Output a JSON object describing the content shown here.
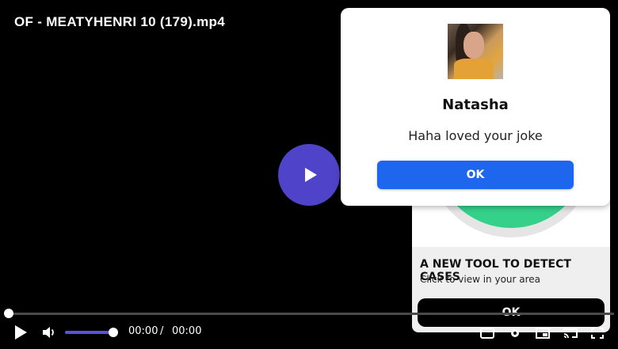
{
  "player": {
    "title": "OF - MEATYHENRI 10 (179).mp4",
    "current_time": "00:00",
    "separator": "/",
    "duration": "00:00",
    "progress": 0,
    "volume": 1.0,
    "accent_color": "#4f43c9"
  },
  "notification": {
    "name": "Natasha",
    "message": "Haha loved your joke",
    "ok_label": "OK",
    "button_color": "#1f66ee"
  },
  "ad": {
    "title": "A NEW TOOL TO DETECT CASES",
    "subtitle": "Click to view in your area",
    "ok_label": "OK",
    "accent_color": "#35d18a"
  },
  "icons": {
    "play": "play-icon",
    "volume": "volume-icon",
    "captions": "captions-icon",
    "settings": "settings-icon",
    "pip": "picture-in-picture-icon",
    "cast": "cast-icon",
    "fullscreen": "fullscreen-icon"
  }
}
